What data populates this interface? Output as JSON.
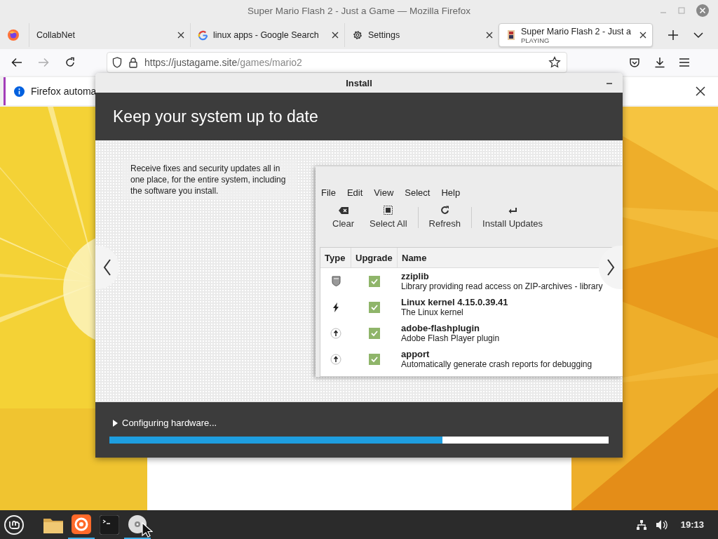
{
  "window": {
    "title": "Super Mario Flash 2 - Just a Game — Mozilla Firefox"
  },
  "tabs": [
    {
      "label": "CollabNet",
      "kind": "plain",
      "selected": false
    },
    {
      "label": "linux apps - Google Search",
      "kind": "search",
      "selected": false
    },
    {
      "label": "Settings",
      "kind": "settings",
      "selected": false
    },
    {
      "label": "Super Mario Flash 2 - Just a",
      "sublabel": "PLAYING",
      "kind": "game",
      "selected": true
    }
  ],
  "nav": {
    "forward_disabled": true,
    "url_host": "https://justagame.site",
    "url_path": "/games/mario2"
  },
  "notification": {
    "text": "Firefox automa"
  },
  "dialog": {
    "title": "Install",
    "heading": "Keep your system up to date",
    "description": "Receive fixes and security updates all in one place, for the entire system, including the software you install.",
    "screenshot": {
      "menu": [
        "File",
        "Edit",
        "View",
        "Select",
        "Help"
      ],
      "toolbar": [
        {
          "label": "Clear",
          "kind": "clear"
        },
        {
          "label": "Select All",
          "kind": "select"
        },
        {
          "label": "Refresh",
          "kind": "refresh"
        },
        {
          "label": "Install Updates",
          "kind": "install"
        }
      ],
      "columns": [
        "Type",
        "Upgrade",
        "Name"
      ],
      "rows": [
        {
          "kind": "security",
          "checked": true,
          "name": "zziplib",
          "description": "Library providing read access on ZIP-archives - library"
        },
        {
          "kind": "kernel",
          "checked": true,
          "name": "Linux kernel 4.15.0.39.41",
          "description": "The Linux kernel"
        },
        {
          "kind": "upgrade",
          "checked": true,
          "name": "adobe-flashplugin",
          "description": "Adobe Flash Player plugin"
        },
        {
          "kind": "upgrade",
          "checked": true,
          "name": "apport",
          "description": "Automatically generate crash reports for debugging"
        }
      ]
    },
    "status": "Configuring hardware...",
    "progress": {
      "level": 0.667
    }
  },
  "taskbar": {
    "apps": [
      {
        "kind": "folder",
        "running": false
      },
      {
        "kind": "firefox",
        "running": true
      },
      {
        "kind": "terminal",
        "running": false
      },
      {
        "kind": "disc",
        "running": true
      }
    ],
    "clock": "19:13"
  }
}
